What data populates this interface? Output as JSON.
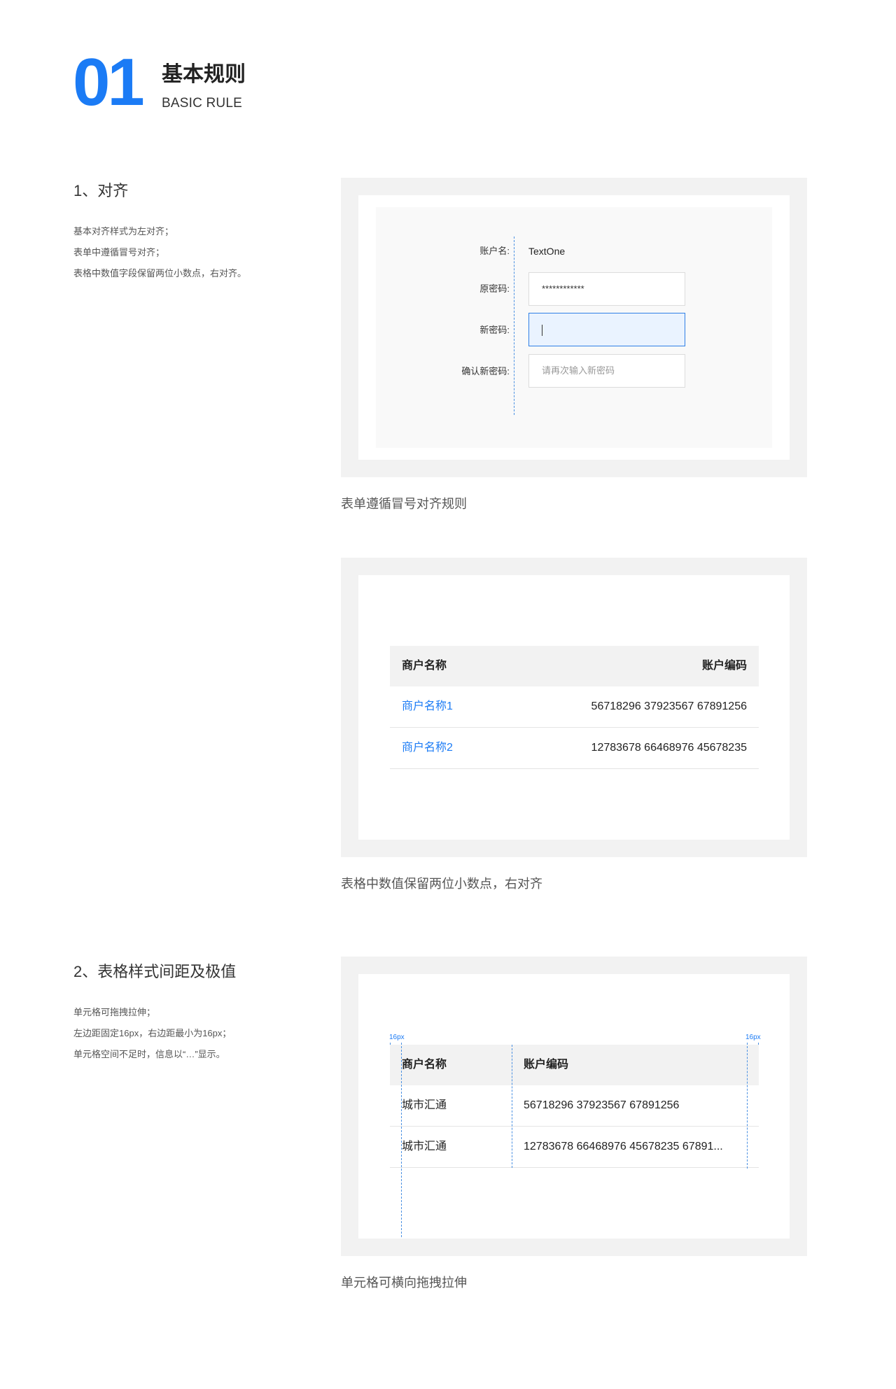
{
  "header": {
    "number": "01",
    "title_cn": "基本规则",
    "title_en": "BASIC RULE"
  },
  "section1": {
    "title": "1、对齐",
    "desc": [
      "基本对齐样式为左对齐；",
      "表单中遵循冒号对齐；",
      "表格中数值字段保留两位小数点，右对齐。"
    ],
    "form": {
      "rows": [
        {
          "label": "账户名:",
          "value": "TextOne"
        },
        {
          "label": "原密码:",
          "value": "************"
        },
        {
          "label": "新密码:",
          "value": ""
        },
        {
          "label": "确认新密码:",
          "placeholder": "请再次输入新密码"
        }
      ]
    },
    "caption1": "表单遵循冒号对齐规则",
    "table": {
      "headers": [
        "商户名称",
        "账户编码"
      ],
      "rows": [
        [
          "商户名称1",
          "56718296 37923567 67891256"
        ],
        [
          "商户名称2",
          "12783678 66468976 45678235"
        ]
      ]
    },
    "caption2": "表格中数值保留两位小数点，右对齐"
  },
  "section2": {
    "title": "2、表格样式间距及极值",
    "desc": [
      "单元格可拖拽拉伸；",
      "左边距固定16px，右边距最小为16px；",
      "单元格空间不足时，信息以“…”显示。"
    ],
    "padding_left_label": "16px",
    "padding_right_label": "16px",
    "table": {
      "headers": [
        "商户名称",
        "账户编码"
      ],
      "rows": [
        [
          "城市汇通",
          "56718296 37923567 67891256"
        ],
        [
          "城市汇通",
          "12783678 66468976 45678235 67891..."
        ]
      ]
    },
    "caption": "单元格可横向拖拽拉伸"
  },
  "colors": {
    "accent": "#1b7bf5",
    "frame": "#f2f2f2",
    "panel": "#f9f9f9",
    "focus": "#eaf3ff"
  }
}
